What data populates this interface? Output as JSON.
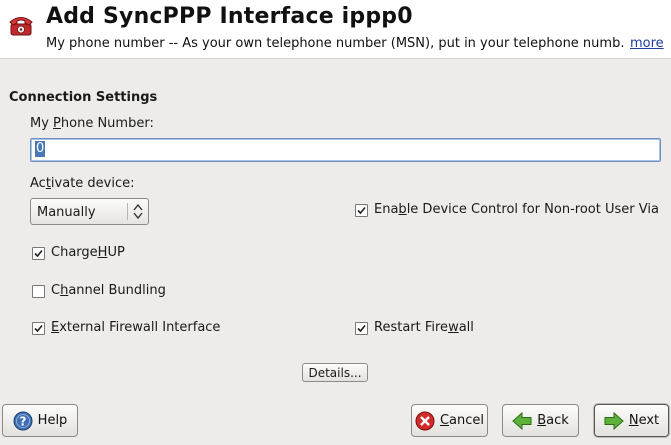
{
  "header": {
    "title": "Add SyncPPP Interface ippp0",
    "help_text": "My phone number -- As your own telephone number (MSN), put in your telephone numb...",
    "more_link": "more",
    "icon": "telephone-icon"
  },
  "section": {
    "title": "Connection Settings"
  },
  "phone_number": {
    "label": "My Phone Number:",
    "mnemonic": "P",
    "value": "0"
  },
  "activate_device": {
    "label": "Activate device:",
    "mnemonic": "t",
    "selected": "Manually"
  },
  "checkboxes": {
    "enable_device_control": {
      "label": "Enable Device Control for Non-root User Via",
      "mnemonic": "b",
      "checked": true
    },
    "charge_hup": {
      "label": "ChargeHUP",
      "mnemonic": "H",
      "checked": true
    },
    "channel_bundling": {
      "label": "Channel Bundling",
      "mnemonic": "h",
      "checked": false
    },
    "external_firewall": {
      "label": "External Firewall Interface",
      "mnemonic": "E",
      "checked": true
    },
    "restart_firewall": {
      "label": "Restart Firewall",
      "mnemonic": "w",
      "checked": true
    }
  },
  "buttons": {
    "details": "Details...",
    "help": "Help",
    "cancel": "Cancel",
    "back": "Back",
    "next": "Next"
  },
  "colors": {
    "link": "#1d3fa0",
    "selection": "#4a78b5",
    "background": "#edeceb"
  }
}
